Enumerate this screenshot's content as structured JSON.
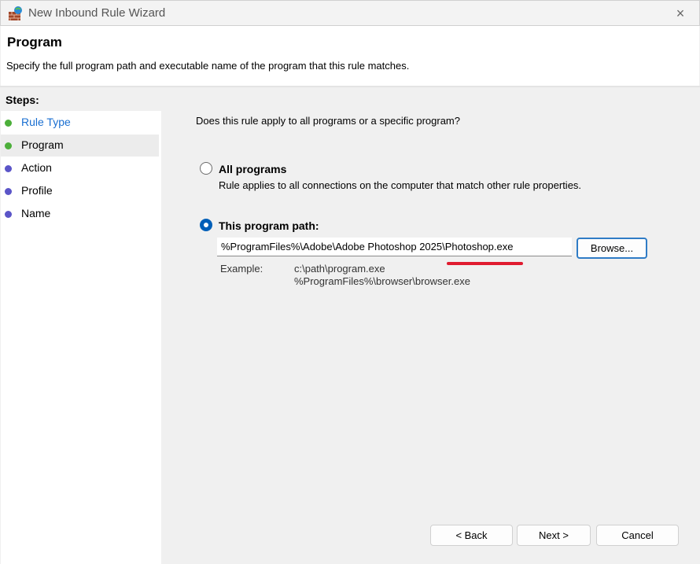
{
  "window": {
    "title": "New Inbound Rule Wizard",
    "close_icon": "×"
  },
  "header": {
    "title": "Program",
    "description": "Specify the full program path and executable name of the program that this rule matches."
  },
  "steps": {
    "heading": "Steps:",
    "items": [
      {
        "label": "Rule Type",
        "color": "#1a6fd1",
        "dot": "#4caf3a"
      },
      {
        "label": "Program",
        "color": "#000",
        "dot": "#4caf3a"
      },
      {
        "label": "Action",
        "color": "#000",
        "dot": "#5b55c8"
      },
      {
        "label": "Profile",
        "color": "#000",
        "dot": "#5b55c8"
      },
      {
        "label": "Name",
        "color": "#000",
        "dot": "#5b55c8"
      }
    ]
  },
  "main": {
    "question": "Does this rule apply to all programs or a specific program?",
    "all_programs": {
      "label": "All programs",
      "description": "Rule applies to all connections on the computer that match other rule properties.",
      "selected": false
    },
    "this_program": {
      "label": "This program path:",
      "selected": true,
      "value": "%ProgramFiles%\\Adobe\\Adobe Photoshop 2025\\Photoshop.exe"
    },
    "browse": "Browse...",
    "example_label": "Example:",
    "example_1": "c:\\path\\program.exe",
    "example_2": "%ProgramFiles%\\browser\\browser.exe"
  },
  "footer": {
    "back": "< Back",
    "next": "Next >",
    "cancel": "Cancel"
  },
  "accent": "#005fb8",
  "annotation_color": "#e01b2f"
}
